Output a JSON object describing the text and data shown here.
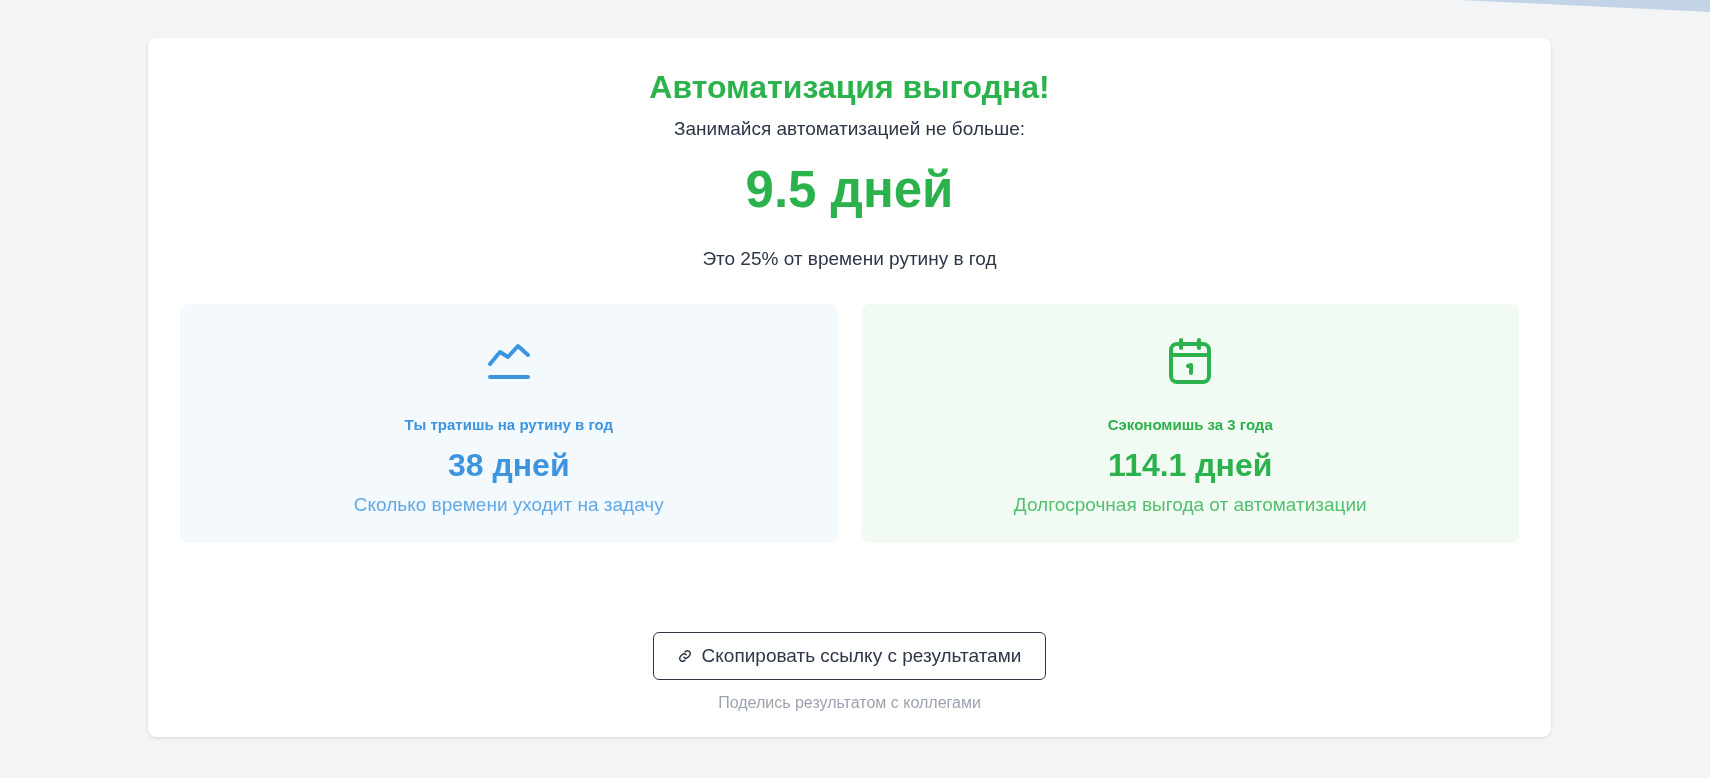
{
  "result": {
    "title": "Автоматизация выгодна!",
    "subtitle": "Занимайся автоматизацией не больше:",
    "value": "9.5 дней",
    "note": "Это 25% от времени рутину в год"
  },
  "stats": [
    {
      "kind": "chart",
      "color": "#3d95e0",
      "label": "Ты тратишь на рутину в год",
      "value": "38 дней",
      "description": "Сколько времени уходит на задачу"
    },
    {
      "kind": "calendar",
      "color": "#2bb24c",
      "label": "Сэкономишь за 3 года",
      "value": "114.1 дней",
      "description": "Долгосрочная выгода от автоматизации"
    }
  ],
  "share": {
    "button": "Скопировать ссылку с результатами",
    "hint": "Поделись результатом с коллегами"
  }
}
